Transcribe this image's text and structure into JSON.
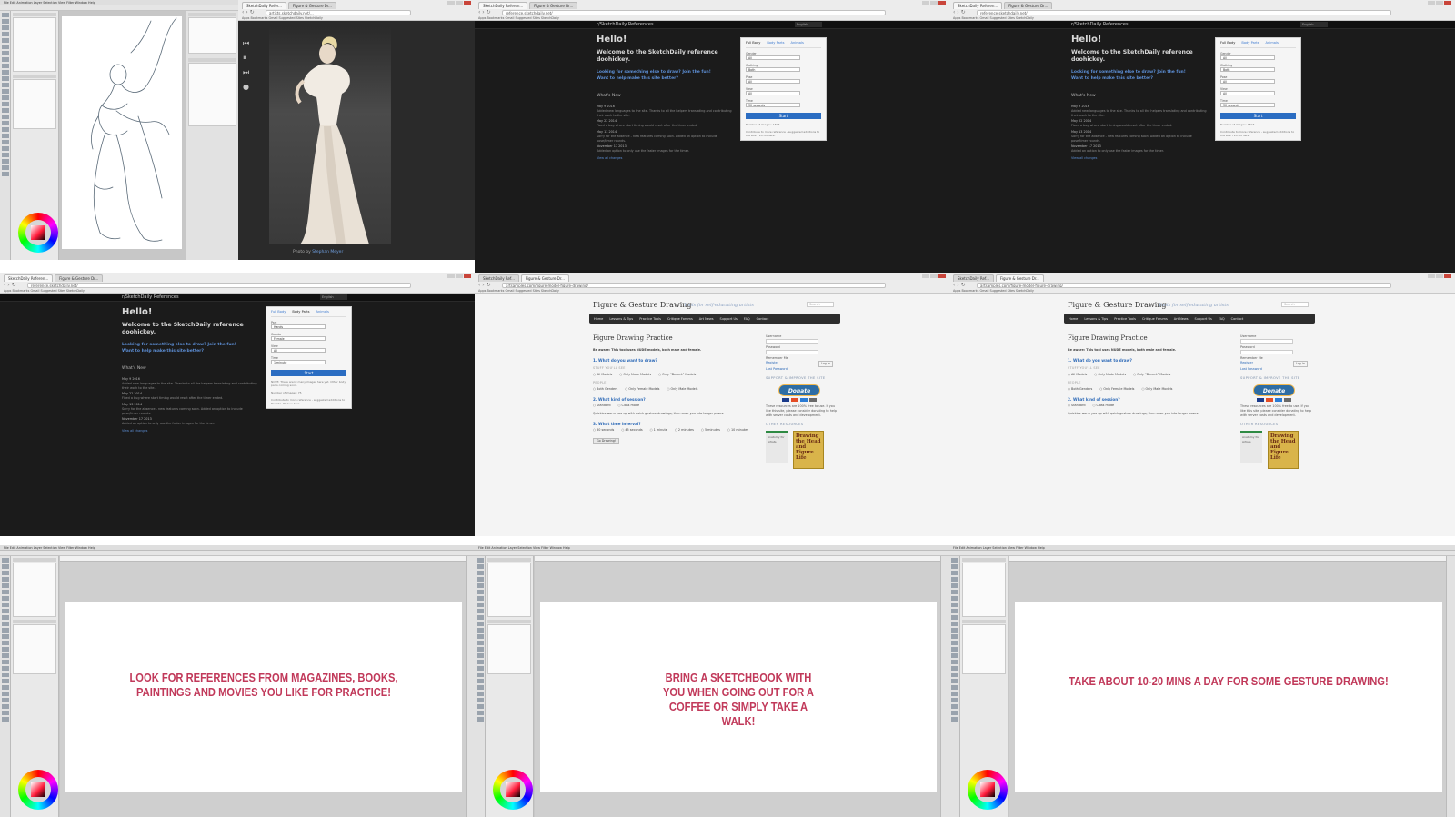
{
  "tiles": {
    "paint_sketch": {
      "menu": "File  Edit  Animation  Layer  Selection  View  Filter  Window  Help"
    },
    "photo_viewer": {
      "tabs": [
        "SketchDaily Refer...",
        "Figure & Gesture Dr..."
      ],
      "url": "artists.sketchdaily.net/...",
      "bookmarks": "Apps  Bookmarks  Gmail  Suggested Sites  SketchDaily",
      "credit_prefix": "Photo by",
      "credit_name": "Stephan Meyer"
    },
    "sketchdaily": {
      "tabs": [
        "SketchDaily Referen...",
        "Figure & Gesture Dr..."
      ],
      "url": "reference.sketchdaily.net/",
      "bookmarks": "Apps  Bookmarks  Gmail  Suggested Sites  SketchDaily",
      "brand": "r/SketchDaily References",
      "lang": "English",
      "hello": "Hello!",
      "welcome": "Welcome to the SketchDaily reference doohickey.",
      "look_prefix": "Looking for something else to draw?",
      "look_link": "Join the fun!",
      "help": "Want to help make this site better?",
      "whats_new": "What's New",
      "news": [
        {
          "date": "May 9 2016",
          "text": "Added new languages to the site. Thanks to all the helpers translating and contributing their work to the site."
        },
        {
          "date": "May 22 2014",
          "text": "Fixed a bug where start timing would reset after the timer ended."
        },
        {
          "date": "May 13 2014",
          "text": "Sorry for the absence - new features coming soon. Added an option to include pose/timer rounds."
        },
        {
          "date": "November 17 2013",
          "text": "Added an option to only use the faster images for the timer."
        }
      ],
      "view_changes": "View all changes",
      "panel_tabs": [
        "Full Body",
        "Body Parts",
        "Animals"
      ],
      "fields": [
        {
          "label": "Gender",
          "value": "All"
        },
        {
          "label": "Clothing",
          "value": "Both"
        },
        {
          "label": "Pose",
          "value": "All"
        },
        {
          "label": "View",
          "value": "All"
        },
        {
          "label": "Time",
          "value": "30 seconds"
        }
      ],
      "start": "Start",
      "note": "Number of images: 1503",
      "suggest": "Contribute to more reference - suggested additions to the site. Find us here."
    },
    "sketchdaily_parts": {
      "fields": [
        {
          "label": "Part",
          "value": "Hands"
        },
        {
          "label": "Gender",
          "value": "Female"
        },
        {
          "label": "View",
          "value": "All"
        },
        {
          "label": "Time",
          "value": "1 minute"
        }
      ],
      "note": "NOTE: There aren't many images here yet. Other body parts coming soon.",
      "images": "Number of images: 75"
    },
    "figure_gesture": {
      "tabs": [
        "SketchDaily Ref...",
        "Figure & Gesture Dr..."
      ],
      "url": "artsamples.com/figure-model-figure-drawing/",
      "bookmarks": "Apps  Bookmarks  Gmail  Suggested Sites  SketchDaily",
      "logo": "Figure & Gesture Drawing",
      "tagline": "Tools for self-educating artists",
      "search": "Search",
      "nav": [
        "Home",
        "Lessons & Tips",
        "Practice Tools",
        "Critique Forums",
        "Art News",
        "Support Us",
        "FAQ",
        "Contact"
      ],
      "heading": "Figure Drawing Practice",
      "aware": "Be aware: This tool uses NUDE models, both male and female.",
      "q1": "1. What do you want to draw?",
      "q1_sub": "STUFF YOU'LL SEE",
      "q1_opts": [
        "All Models",
        "Only Nude Models",
        "Only \"Decent\" Models"
      ],
      "q1_sub2": "PEOPLE",
      "q1_opts2": [
        "Both Genders",
        "Only Female Models",
        "Only Male Models"
      ],
      "q2": "2. What kind of session?",
      "q2_opts": [
        "Standard",
        "Class mode"
      ],
      "q2_desc": "Quickies warm you up with quick gesture drawings, then ease you into longer poses.",
      "q3": "3. What time interval?",
      "q3_opts": [
        "30 seconds",
        "45 seconds",
        "1 minute",
        "2 minutes",
        "5 minutes",
        "10 minutes"
      ],
      "go": "Go Drawing!",
      "username": "Username",
      "password": "Password",
      "remember": "Remember Me",
      "login": "Log in",
      "register": "Register",
      "lost": "Lost Password",
      "support": "SUPPORT & IMPROVE THE SITE",
      "donate": "Donate",
      "support_text": "These resources are 100% free to use. If you like this site, please consider donating to help with server costs and development.",
      "other": "OTHER RESOURCES",
      "book1": "Anatomy for Artists",
      "book2": "Drawing the Head and Figure Life"
    },
    "paint_tip1": {
      "caption": "LOOK FOR REFERENCES FROM MAGAZINES, BOOKS, PAINTINGS AND MOVIES YOU LIKE FOR PRACTICE!"
    },
    "paint_tip2": {
      "caption": "BRING A SKETCHBOOK WITH YOU WHEN GOING OUT FOR A COFFEE OR SIMPLY TAKE A WALK!"
    },
    "paint_tip3": {
      "caption": "TAKE ABOUT 10-20 MINS A DAY FOR SOME GESTURE DRAWING!"
    }
  },
  "colors": {
    "caption": "#c1395a",
    "link": "#5d8fd6",
    "start": "#2b6dc2"
  }
}
